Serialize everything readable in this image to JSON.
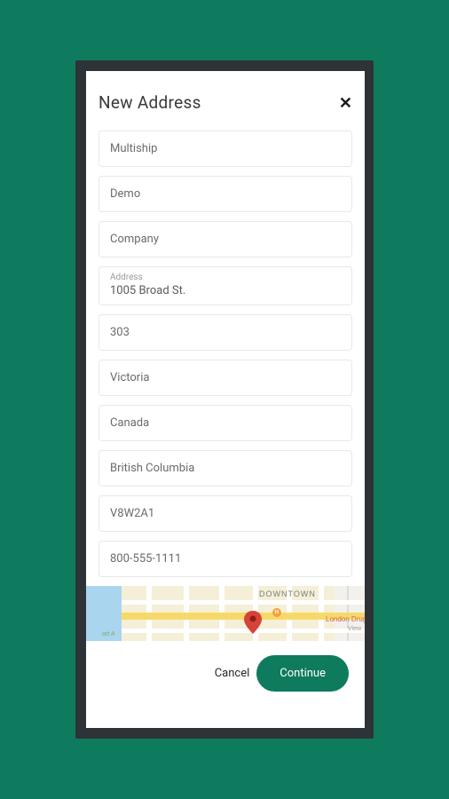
{
  "modal": {
    "title": "New Address",
    "close_label": "✕"
  },
  "fields": {
    "first_name": {
      "value": "Multiship"
    },
    "last_name": {
      "value": "Demo"
    },
    "company": {
      "value": "Company"
    },
    "address": {
      "label": "Address",
      "value": "1005 Broad St."
    },
    "address2": {
      "value": "303"
    },
    "city": {
      "value": "Victoria"
    },
    "country": {
      "value": "Canada"
    },
    "province": {
      "value": "British Columbia"
    },
    "postal": {
      "value": "V8W2A1"
    },
    "phone": {
      "value": "800-555-1111"
    }
  },
  "map": {
    "area_label": "DOWNTOWN",
    "marker_icon": "map-pin",
    "poi_labels": [
      "London Drugs",
      "View"
    ],
    "port_label": "ort A"
  },
  "actions": {
    "cancel_label": "Cancel",
    "continue_label": "Continue"
  }
}
